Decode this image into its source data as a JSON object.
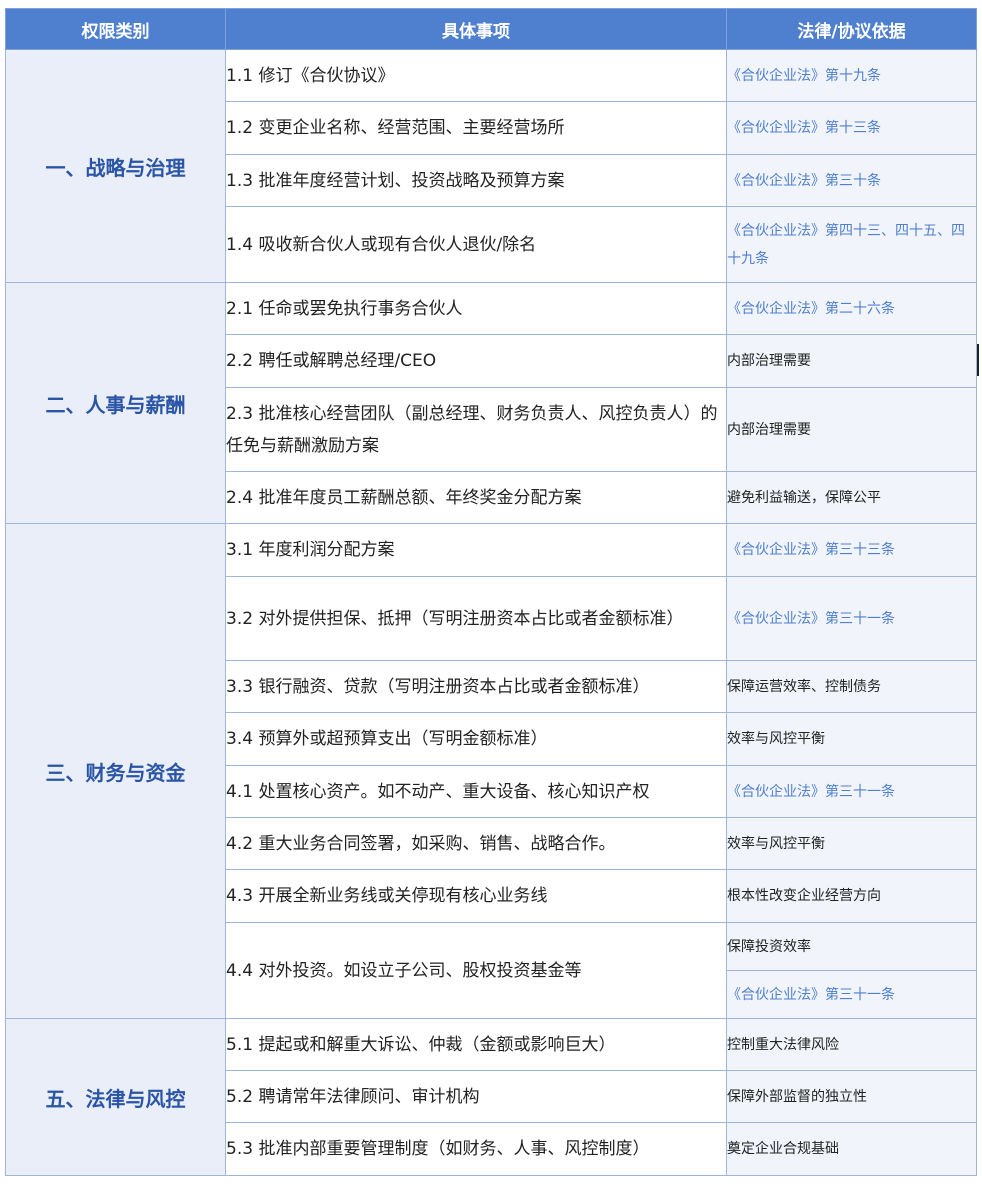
{
  "headers": [
    "权限类别",
    "具体事项",
    "法律/协议依据"
  ],
  "categories": [
    {
      "name": "一、战略与治理",
      "items": [
        {
          "text": "1.1  修订《合伙协议》",
          "basis": "《合伙企业法》第十九条",
          "kind": "law",
          "h": 52
        },
        {
          "text": "1.2  变更企业名称、经营范围、主要经营场所",
          "basis": "《合伙企业法》第十三条",
          "kind": "law",
          "h": 53
        },
        {
          "text": "1.3  批准年度经营计划、投资战略及预算方案",
          "basis": "《合伙企业法》第三十条",
          "kind": "law",
          "h": 52
        },
        {
          "text": "1.4  吸收新合伙人或现有合伙人退伙/除名",
          "basis": "《合伙企业法》第四十三、四十五、四十九条",
          "kind": "law",
          "h": 76
        }
      ]
    },
    {
      "name": "二、人事与薪酬",
      "items": [
        {
          "text": "2.1  任命或罢免执行事务合伙人",
          "basis": "《合伙企业法》第二十六条",
          "kind": "law",
          "h": 52
        },
        {
          "text": "2.2  聘任或解聘总经理/CEO",
          "basis": "内部治理需要",
          "kind": "note",
          "h": 53
        },
        {
          "text": "2.3  批准核心经营团队（副总经理、财务负责人、风控负责人）的任免与薪酬激励方案",
          "basis": "内部治理需要",
          "kind": "note",
          "h": 84
        },
        {
          "text": "2.4  批准年度员工薪酬总额、年终奖金分配方案",
          "basis": "避免利益输送，保障公平",
          "kind": "note",
          "h": 52
        }
      ]
    },
    {
      "name": "三、财务与资金",
      "items": [
        {
          "text": "3.1  年度利润分配方案",
          "basis": "《合伙企业法》第三十三条",
          "kind": "law",
          "h": 53
        },
        {
          "text": "3.2  对外提供担保、抵押（写明注册资本占比或者金额标准）",
          "basis": "《合伙企业法》第三十一条",
          "kind": "law",
          "h": 84
        },
        {
          "text": "3.3  银行融资、贷款（写明注册资本占比或者金额标准）",
          "basis": "保障运营效率、控制债务",
          "kind": "note",
          "h": 52
        },
        {
          "text": "3.4  预算外或超预算支出（写明金额标准）",
          "basis": "效率与风控平衡",
          "kind": "note",
          "h": 53
        },
        {
          "text": "4.1  处置核心资产。如不动产、重大设备、核心知识产权",
          "basis": "《合伙企业法》第三十一条",
          "kind": "law",
          "h": 52
        },
        {
          "text": "4.2  重大业务合同签署，如采购、销售、战略合作。",
          "basis": "效率与风控平衡",
          "kind": "note",
          "h": 52
        },
        {
          "text": "4.3  开展全新业务线或关停现有核心业务线",
          "basis": "根本性改变企业经营方向",
          "kind": "note",
          "h": 53
        }
      ],
      "split_item": {
        "text": "4.4  对外投资。如设立子公司、股权投资基金等",
        "bases": [
          {
            "text": "保障投资效率",
            "kind": "note",
            "h": 48
          },
          {
            "text": "《合伙企业法》第三十一条",
            "kind": "law",
            "h": 48
          }
        ]
      }
    },
    {
      "name": "五、法律与风控",
      "items": [
        {
          "text": "5.1  提起或和解重大诉讼、仲裁（金额或影响巨大）",
          "basis": "控制重大法律风险",
          "kind": "note",
          "h": 52
        },
        {
          "text": "5.2  聘请常年法律顾问、审计机构",
          "basis": "保障外部监督的独立性",
          "kind": "note",
          "h": 52
        },
        {
          "text": "5.3  批准内部重要管理制度（如财务、人事、风控制度）",
          "basis": "奠定企业合规基础",
          "kind": "note",
          "h": 53
        }
      ]
    }
  ]
}
